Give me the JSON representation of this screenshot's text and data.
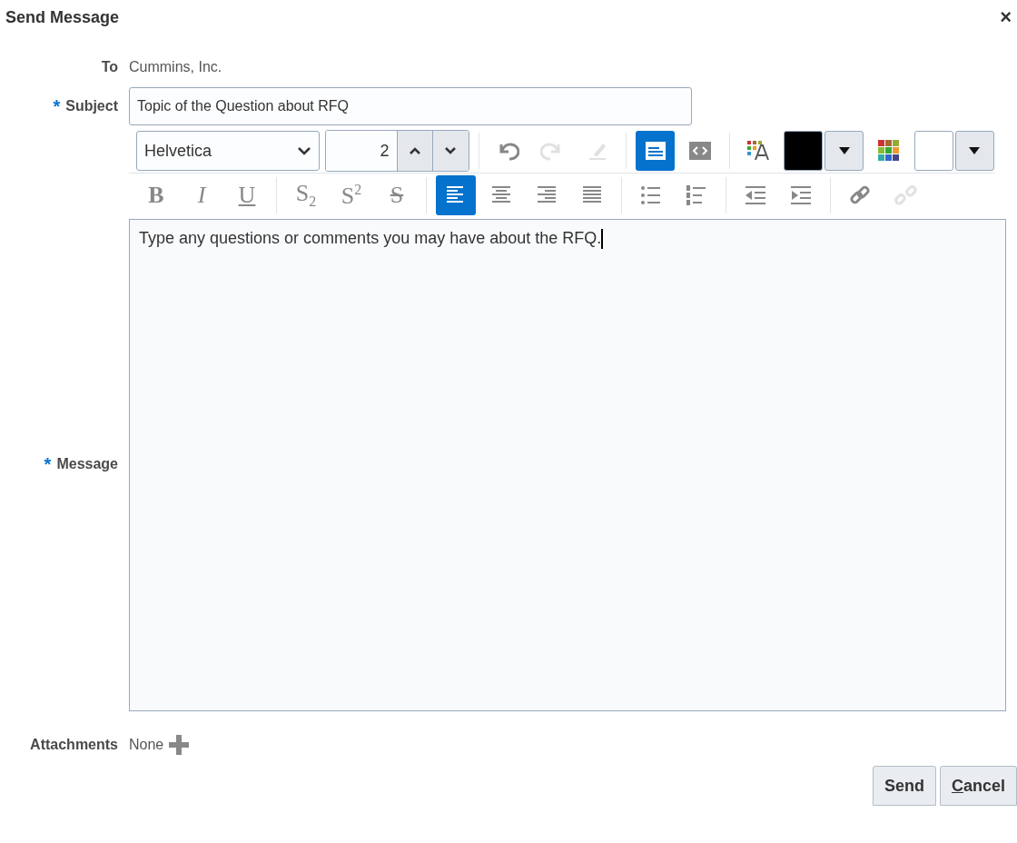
{
  "dialog": {
    "title": "Send Message",
    "close": "×"
  },
  "to": {
    "label": "To",
    "value": "Cummins, Inc."
  },
  "subject": {
    "label": "Subject",
    "required_mark": "*",
    "value": "Topic of the Question about RFQ"
  },
  "toolbar_rows": [
    [
      {
        "kind": "select",
        "value": "Helvetica"
      },
      {
        "kind": "spinner",
        "value": "2"
      },
      {
        "kind": "sep"
      },
      {
        "kind": "icon",
        "selected": false,
        "disabled": false
      },
      {
        "kind": "icon",
        "selected": false,
        "disabled": true
      },
      {
        "kind": "icon",
        "selected": false,
        "disabled": true
      },
      {
        "kind": "sep"
      },
      {
        "kind": "icon",
        "selected": true,
        "disabled": false
      },
      {
        "kind": "icon",
        "selected": false,
        "disabled": false
      },
      {
        "kind": "sep"
      },
      {
        "kind": "icon",
        "selected": false,
        "disabled": false
      },
      {
        "kind": "swatch",
        "color": "#000000"
      },
      {
        "kind": "icon",
        "selected": false,
        "disabled": false
      },
      {
        "kind": "swatch",
        "color": "#ffffff"
      }
    ],
    [
      {
        "kind": "glyph",
        "label": "B"
      },
      {
        "kind": "glyph",
        "label": "I"
      },
      {
        "kind": "glyph",
        "label": "U"
      },
      {
        "kind": "sep"
      },
      {
        "kind": "glyph",
        "label": "S$_{2}$"
      },
      {
        "kind": "glyph",
        "label": "S$^{2}$"
      },
      {
        "kind": "glyph",
        "label": "S"
      },
      {
        "kind": "sep"
      },
      {
        "kind": "icon",
        "selected": true,
        "disabled": false
      },
      {
        "kind": "icon",
        "selected": false,
        "disabled": false
      },
      {
        "kind": "icon",
        "selected": false,
        "disabled": false
      },
      {
        "kind": "icon",
        "selected": false,
        "disabled": false
      },
      {
        "kind": "sep"
      },
      {
        "kind": "icon",
        "selected": false,
        "disabled": false
      },
      {
        "kind": "icon",
        "selected": false,
        "disabled": false
      },
      {
        "kind": "sep"
      },
      {
        "kind": "icon",
        "selected": false,
        "disabled": false
      },
      {
        "kind": "icon",
        "selected": false,
        "disabled": false
      },
      {
        "kind": "sep"
      },
      {
        "kind": "icon",
        "selected": false,
        "disabled": false
      },
      {
        "kind": "icon",
        "selected": false,
        "disabled": true
      }
    ]
  ],
  "message": {
    "label": "Message",
    "required_mark": "*",
    "value": "Type any questions or comments you may have about the RFQ."
  },
  "attachments": {
    "label": "Attachments",
    "value": "None"
  },
  "buttons": [
    {
      "label": "Send",
      "underline_first": false
    },
    {
      "label": "Cancel",
      "underline_first": true
    }
  ]
}
